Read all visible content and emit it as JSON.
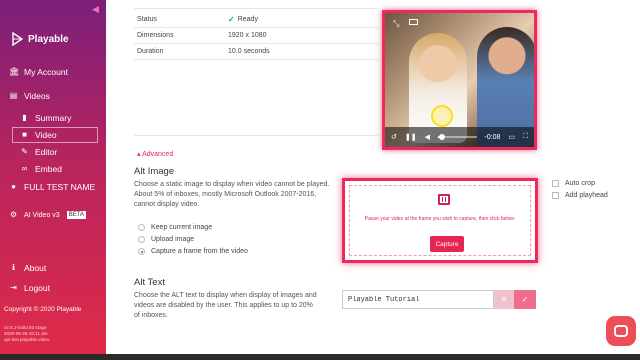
{
  "sidebar": {
    "brand": "Playable",
    "items": [
      {
        "label": "My Account",
        "icon": "bank-icon"
      },
      {
        "label": "Videos",
        "icon": "film-icon"
      },
      {
        "label": "Summary",
        "icon": "bar-chart-icon"
      },
      {
        "label": "Video",
        "icon": "video-camera-icon"
      },
      {
        "label": "Editor",
        "icon": "pencil-icon"
      },
      {
        "label": "Embed",
        "icon": "link-icon"
      },
      {
        "label": "FULL TEST NAME",
        "icon": "user-icon"
      },
      {
        "label": "AI Video v3",
        "icon": "gear-icon",
        "badge": "BETA"
      },
      {
        "label": "About",
        "icon": "info-icon"
      },
      {
        "label": "Logout",
        "icon": "logout-icon"
      }
    ],
    "copyright": "Copyright © 2020 Playable",
    "build": [
      "v2.6.2-build.93 stage",
      "2020-08-26 10:11 am",
      "api-dev.playable.video"
    ]
  },
  "info": {
    "rows": [
      {
        "key": "Status",
        "value": "Ready"
      },
      {
        "key": "Dimensions",
        "value": "1920 x 1080"
      },
      {
        "key": "Duration",
        "value": "10.0 seconds"
      }
    ]
  },
  "player": {
    "time": "-0:08",
    "progress": 0.1
  },
  "advanced_label": "▴ Advanced",
  "alt_image": {
    "title": "Alt Image",
    "description": "Choose a static image to display when video cannot be played. About 5% of inboxes, mostly Microsoft Outlook 2007-2016, cannot display video.",
    "options": [
      "Keep current image",
      "Upload image",
      "Capture a frame from the video"
    ],
    "selected": 2,
    "capture_message": "Pause your video at the frame you wish to capture, then click below:",
    "capture_button": "Capture",
    "checkboxes": [
      "Auto crop",
      "Add playhead"
    ]
  },
  "alt_text": {
    "title": "Alt Text",
    "description": "Choose the ALT text to display when display of images and videos are disabled by the user. This applies to up to 20% of inboxes.",
    "value": "Playable Tutorial"
  },
  "colors": {
    "accent": "#ee2a5d",
    "success": "#27a844"
  }
}
